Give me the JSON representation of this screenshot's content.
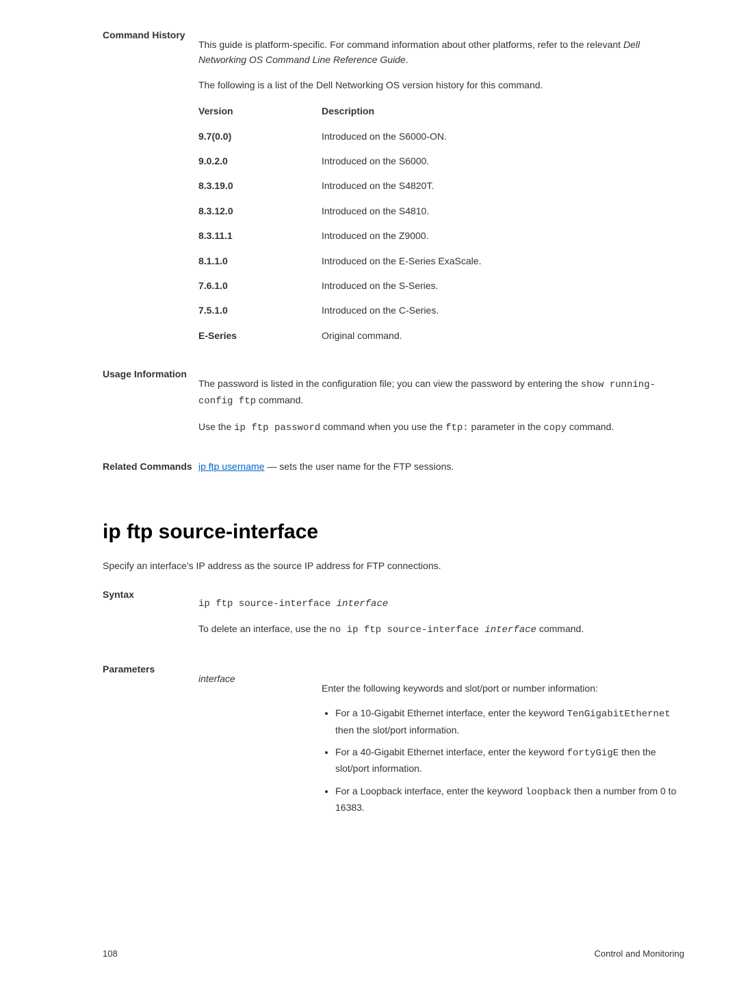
{
  "command_history": {
    "label": "Command History",
    "intro1": "This guide is platform-specific. For command information about other platforms, refer to the relevant ",
    "intro1_italic": "Dell Networking OS Command Line Reference Guide",
    "intro1_end": ".",
    "intro2": "The following is a list of the Dell Networking OS version history for this command.",
    "header_version": "Version",
    "header_description": "Description",
    "rows": [
      {
        "version": "9.7(0.0)",
        "desc": "Introduced on the S6000-ON."
      },
      {
        "version": "9.0.2.0",
        "desc": "Introduced on the S6000."
      },
      {
        "version": "8.3.19.0",
        "desc": "Introduced on the S4820T."
      },
      {
        "version": "8.3.12.0",
        "desc": "Introduced on the S4810."
      },
      {
        "version": "8.3.11.1",
        "desc": "Introduced on the Z9000."
      },
      {
        "version": "8.1.1.0",
        "desc": "Introduced on the E-Series ExaScale."
      },
      {
        "version": "7.6.1.0",
        "desc": "Introduced on the S-Series."
      },
      {
        "version": "7.5.1.0",
        "desc": "Introduced on the C-Series."
      },
      {
        "version": "E-Series",
        "desc": "Original command."
      }
    ]
  },
  "usage_info": {
    "label": "Usage Information",
    "p1_a": "The password is listed in the configuration file; you can view the password by entering the ",
    "p1_code": "show running-config ftp",
    "p1_b": " command.",
    "p2_a": "Use the ",
    "p2_code1": "ip ftp password",
    "p2_b": " command when you use the ",
    "p2_code2": "ftp:",
    "p2_c": " parameter in the ",
    "p2_code3": "copy",
    "p2_d": " command."
  },
  "related": {
    "label": "Related Commands",
    "link": "ip ftp username",
    "tail": " — sets the user name for the FTP sessions."
  },
  "section": {
    "title": "ip ftp source-interface",
    "subtitle": "Specify an interface's IP address as the source IP address for FTP connections."
  },
  "syntax": {
    "label": "Syntax",
    "code1_a": "ip ftp source-interface ",
    "code1_param": "interface",
    "p2_a": "To delete an interface, use the ",
    "p2_code": "no ip ftp source-interface ",
    "p2_param": "interface",
    "p2_b": " command."
  },
  "parameters": {
    "label": "Parameters",
    "param_name": "interface",
    "intro": "Enter the following keywords and slot/port or number information:",
    "bullets": [
      {
        "pre": "For a 10-Gigabit Ethernet interface, enter the keyword ",
        "code": "TenGigabitEthernet",
        "post": " then the slot/port information."
      },
      {
        "pre": "For a 40-Gigabit Ethernet interface, enter the keyword ",
        "code": "fortyGigE",
        "post": " then the slot/port information."
      },
      {
        "pre": "For a Loopback interface, enter the keyword ",
        "code": "loopback",
        "post": " then a number from 0 to 16383."
      }
    ]
  },
  "footer": {
    "page": "108",
    "title": "Control and Monitoring"
  }
}
